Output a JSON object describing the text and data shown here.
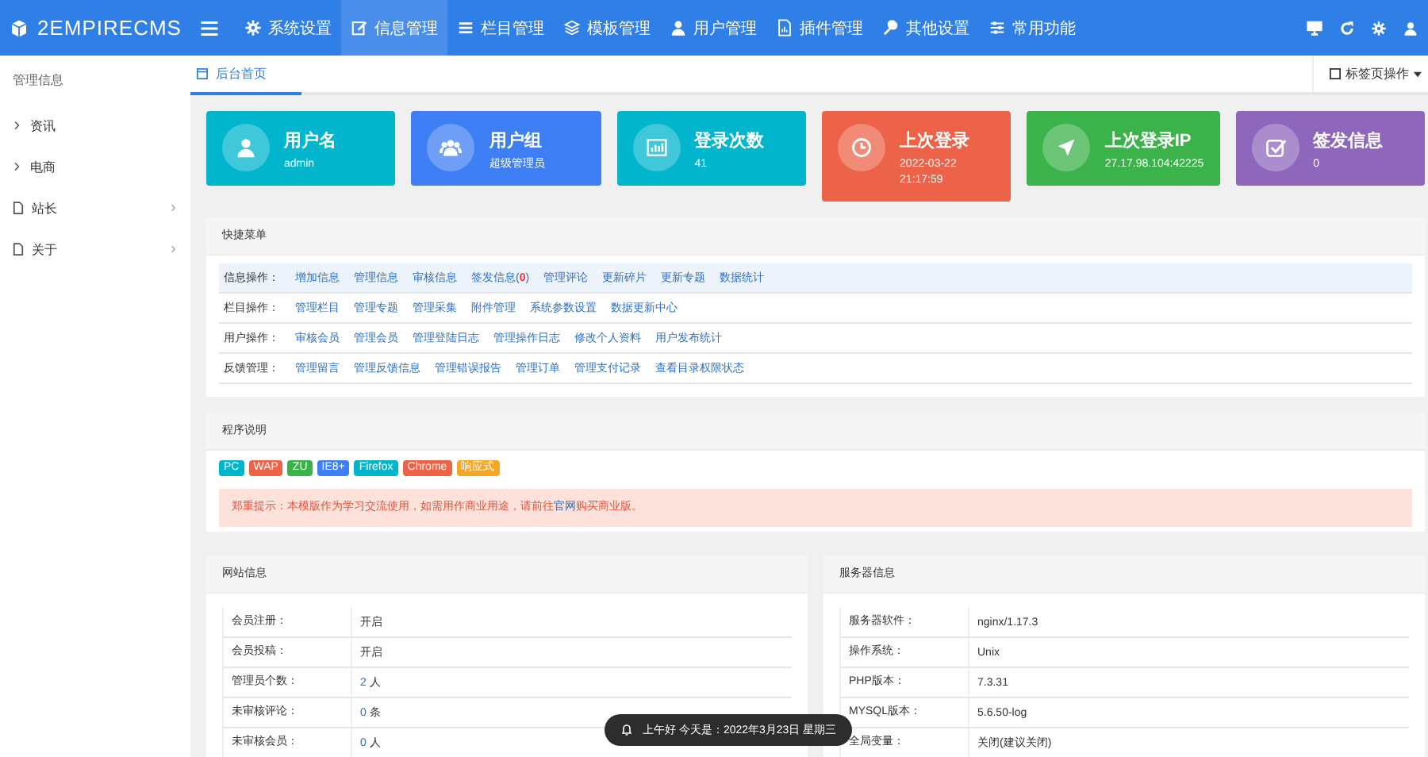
{
  "logo": {
    "text": "2EMPIRECMS"
  },
  "nav": [
    {
      "label": "系统设置",
      "selected": false
    },
    {
      "label": "信息管理",
      "selected": true
    },
    {
      "label": "栏目管理",
      "selected": false
    },
    {
      "label": "模板管理",
      "selected": false
    },
    {
      "label": "用户管理",
      "selected": false
    },
    {
      "label": "插件管理",
      "selected": false
    },
    {
      "label": "其他设置",
      "selected": false
    },
    {
      "label": "常用功能",
      "selected": false
    }
  ],
  "tabs": [
    {
      "label": "后台首页",
      "selected": true
    }
  ],
  "tab_menu": "标签页操作",
  "sidebar": {
    "title": "管理信息",
    "items": [
      {
        "label": "资讯",
        "kind": "plain"
      },
      {
        "label": "电商",
        "kind": "plain"
      },
      {
        "label": "站长",
        "kind": "doc"
      },
      {
        "label": "关于",
        "kind": "doc"
      }
    ]
  },
  "cards": [
    {
      "title": "用户名",
      "lines": [
        "admin"
      ],
      "color": "#00b5cc"
    },
    {
      "title": "用户组",
      "lines": [
        "超级管理员"
      ],
      "color": "#3f7ff5"
    },
    {
      "title": "登录次数",
      "lines": [
        "41"
      ],
      "color": "#00b5cc"
    },
    {
      "title": "上次登录",
      "lines": [
        "2022-03-22",
        "21:17:59"
      ],
      "color": "#ec6349"
    },
    {
      "title": "上次登录IP",
      "lines": [
        "27.17.98.104:42225"
      ],
      "color": "#3bb24a"
    },
    {
      "title": "签发信息",
      "lines": [
        "0"
      ],
      "color": "#8e67bd"
    }
  ],
  "quick_menu": {
    "title": "快捷菜单",
    "rows": [
      {
        "label": "信息操作：",
        "links": [
          "增加信息",
          "管理信息",
          "审核信息",
          "签发信息(**0**)",
          "管理评论",
          "更新碎片",
          "更新专题",
          "数据统计"
        ]
      },
      {
        "label": "栏目操作：",
        "links": [
          "管理栏目",
          "管理专题",
          "管理采集",
          "附件管理",
          "系统参数设置",
          "数据更新中心"
        ]
      },
      {
        "label": "用户操作：",
        "links": [
          "审核会员",
          "管理会员",
          "管理登陆日志",
          "管理操作日志",
          "修改个人资料",
          "用户发布统计"
        ]
      },
      {
        "label": "反馈管理：",
        "links": [
          "管理留言",
          "管理反馈信息",
          "管理错误报告",
          "管理订单",
          "管理支付记录",
          "查看目录权限状态"
        ]
      }
    ]
  },
  "program": {
    "title": "程序说明",
    "tags": [
      {
        "label": "PC",
        "color": "#00b5cc"
      },
      {
        "label": "WAP",
        "color": "#ec6349"
      },
      {
        "label": "ZU",
        "color": "#3bb24a"
      },
      {
        "label": "IE8+",
        "color": "#3f7ff5"
      },
      {
        "label": "Firefox",
        "color": "#00b5cc"
      },
      {
        "label": "Chrome",
        "color": "#ec6349"
      },
      {
        "label": "响应式",
        "color": "#f5a623"
      }
    ],
    "notice": "郑重提示：本模版作为学习交流使用，如需用作商业用途，请前往",
    "notice_link": "官网",
    "notice_end": "购买商业版。"
  },
  "site_info": {
    "title": "网站信息",
    "rows": [
      {
        "label": "会员注册：",
        "value": "开启"
      },
      {
        "label": "会员投稿：",
        "value": "开启"
      },
      {
        "label": "管理员个数：",
        "count": "2",
        "unit": "人"
      },
      {
        "label": "未审核评论：",
        "count": "0",
        "unit": "条"
      },
      {
        "label": "未审核会员：",
        "count": "0",
        "unit": "人"
      }
    ]
  },
  "server_info": {
    "title": "服务器信息",
    "rows": [
      {
        "label": "服务器软件：",
        "value": "nginx/1.17.3"
      },
      {
        "label": "操作系统：",
        "value": "Unix"
      },
      {
        "label": "PHP版本：",
        "value": "7.3.31"
      },
      {
        "label": "MYSQL版本：",
        "value": "5.6.50-log"
      },
      {
        "label": "全局变量：",
        "value": "关闭(建议关闭)"
      }
    ]
  },
  "toast": "上午好 今天是：2022年3月23日 星期三"
}
